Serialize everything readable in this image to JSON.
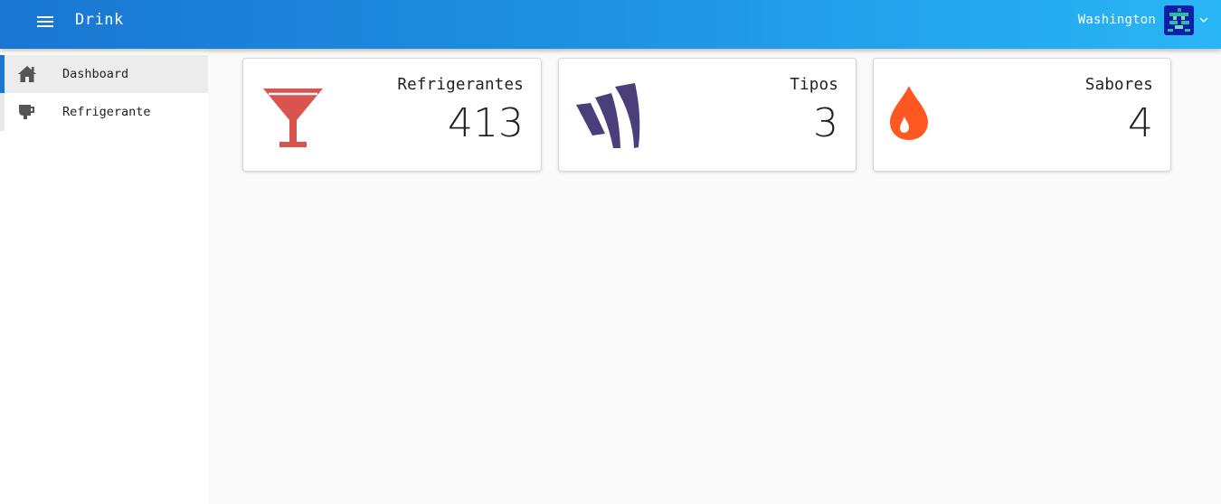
{
  "header": {
    "app_title": "Drink",
    "user_name": "Washington",
    "menu_icon": "hamburger-icon",
    "dropdown_icon": "chevron-down-icon",
    "gradient_start": "#1976d2",
    "gradient_end": "#29b6f6"
  },
  "sidebar": {
    "items": [
      {
        "label": "Dashboard",
        "icon": "home-icon",
        "active": true
      },
      {
        "label": "Refrigerante",
        "icon": "mug-icon",
        "active": false
      }
    ],
    "active_color": "#1976d2"
  },
  "cards": [
    {
      "title": "Refrigerantes",
      "value": "413",
      "icon": "cocktail-glass-icon",
      "color": "#d9534f"
    },
    {
      "title": "Tipos",
      "value": "3",
      "icon": "stripes-logo-icon",
      "color": "#4a3f7a"
    },
    {
      "title": "Sabores",
      "value": "4",
      "icon": "drop-icon",
      "color": "#ff5722"
    }
  ]
}
